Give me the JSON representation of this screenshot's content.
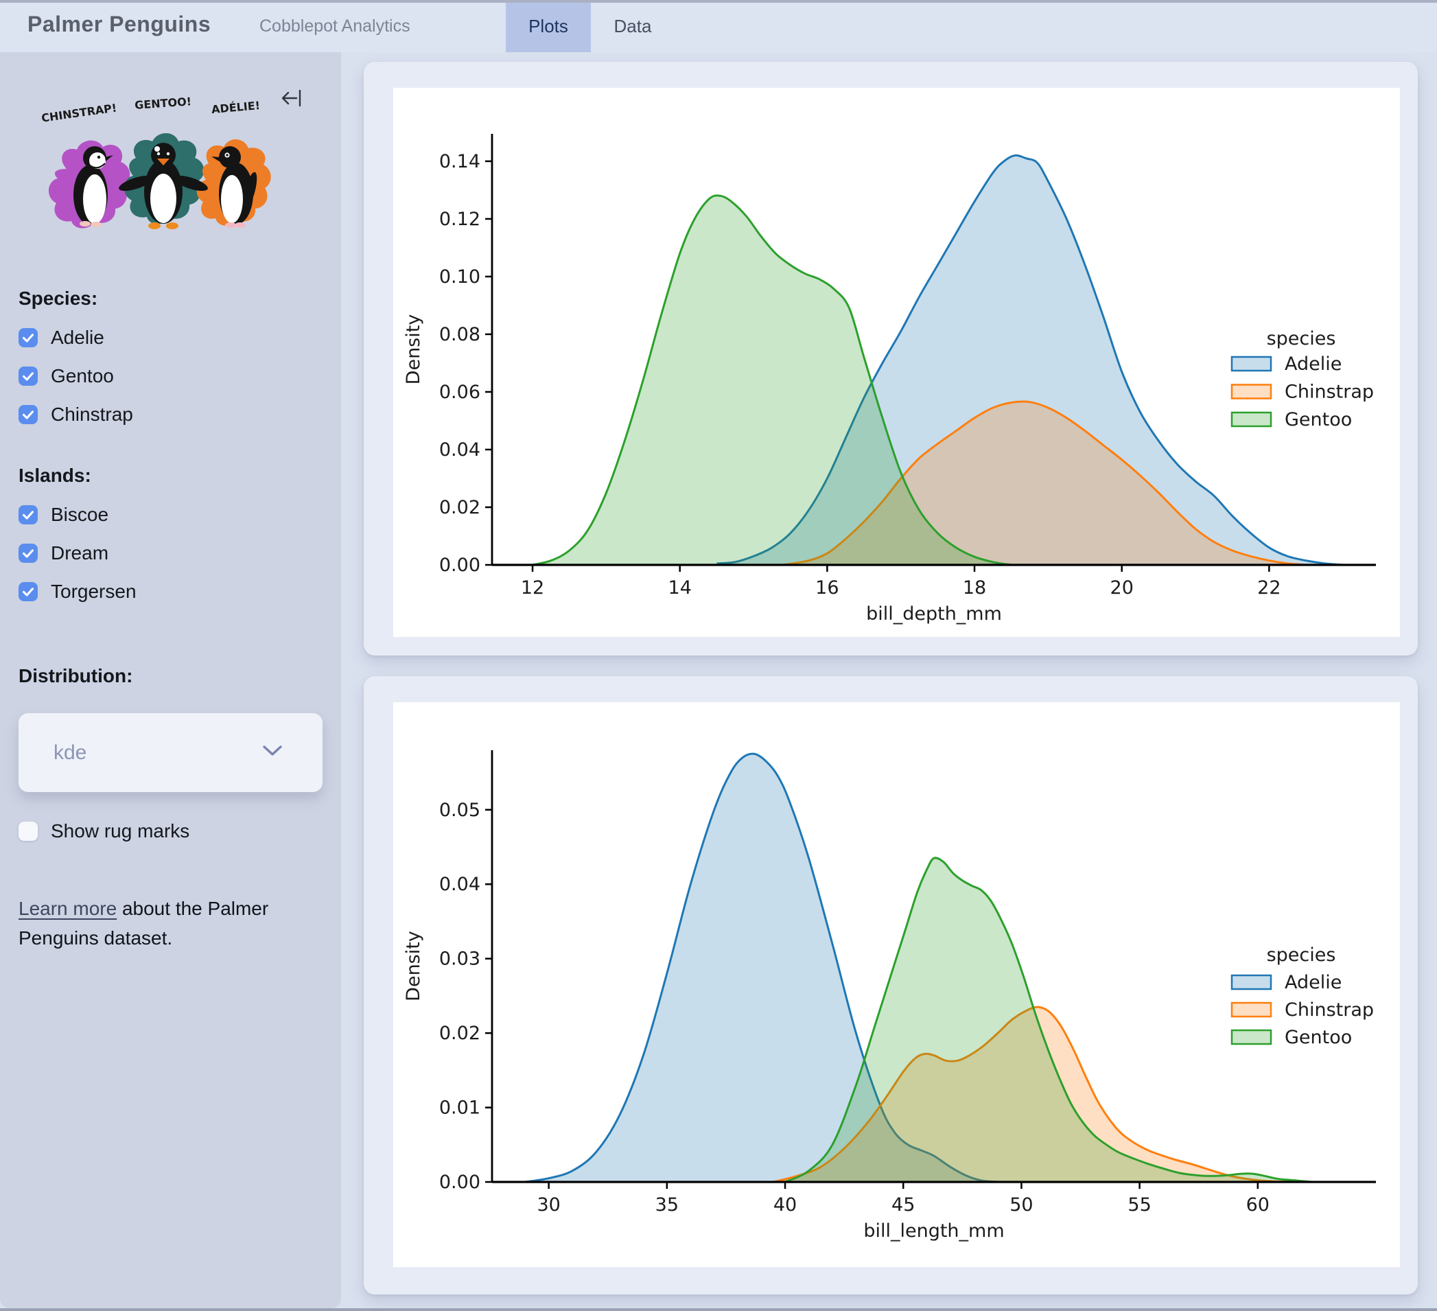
{
  "header": {
    "title": "Palmer Penguins",
    "subtitle": "Cobblepot Analytics",
    "tabs": [
      {
        "label": "Plots",
        "active": true
      },
      {
        "label": "Data",
        "active": false
      }
    ]
  },
  "sidebar": {
    "artwork_labels": {
      "chinstrap": "CHINSTRAP!",
      "gentoo": "GENTOO!",
      "adelie": "ADÉLIE!"
    },
    "species": {
      "label": "Species:",
      "options": [
        {
          "label": "Adelie",
          "checked": true
        },
        {
          "label": "Gentoo",
          "checked": true
        },
        {
          "label": "Chinstrap",
          "checked": true
        }
      ]
    },
    "islands": {
      "label": "Islands:",
      "options": [
        {
          "label": "Biscoe",
          "checked": true
        },
        {
          "label": "Dream",
          "checked": true
        },
        {
          "label": "Torgersen",
          "checked": true
        }
      ]
    },
    "distribution": {
      "label": "Distribution:",
      "value": "kde"
    },
    "rug": {
      "label": "Show rug marks",
      "checked": false
    },
    "footer": {
      "link_text": "Learn more",
      "rest": " about the Palmer Penguins dataset."
    }
  },
  "colors": {
    "adelie": "#1f77b4",
    "chinstrap": "#ff7f0e",
    "gentoo": "#2ca02c",
    "checkbox_accent": "#5a8dee",
    "active_tab_bg": "#b5c4e6"
  },
  "chart_data": [
    {
      "type": "area",
      "subtype": "kde",
      "title": "",
      "xlabel": "bill_depth_mm",
      "ylabel": "Density",
      "xlim": [
        11.45,
        23.45
      ],
      "ylim": [
        0,
        0.1495
      ],
      "xticks": [
        12,
        14,
        16,
        18,
        20,
        22
      ],
      "yticks": [
        0.0,
        0.02,
        0.04,
        0.06,
        0.08,
        0.1,
        0.12,
        0.14
      ],
      "grid": false,
      "legend": {
        "title": "species",
        "position": "right"
      },
      "series": [
        {
          "name": "Adelie",
          "color": "#1f77b4",
          "points": [
            [
              14.5,
              0.0005
            ],
            [
              14.75,
              0.001
            ],
            [
              15.0,
              0.003
            ],
            [
              15.25,
              0.006
            ],
            [
              15.5,
              0.011
            ],
            [
              15.75,
              0.019
            ],
            [
              16.0,
              0.03
            ],
            [
              16.25,
              0.044
            ],
            [
              16.5,
              0.058
            ],
            [
              16.75,
              0.07
            ],
            [
              17.0,
              0.081
            ],
            [
              17.25,
              0.093
            ],
            [
              17.5,
              0.104
            ],
            [
              17.75,
              0.115
            ],
            [
              18.0,
              0.126
            ],
            [
              18.25,
              0.136
            ],
            [
              18.4,
              0.14
            ],
            [
              18.55,
              0.142
            ],
            [
              18.7,
              0.141
            ],
            [
              18.85,
              0.1395
            ],
            [
              19.0,
              0.133
            ],
            [
              19.25,
              0.12
            ],
            [
              19.5,
              0.104
            ],
            [
              19.75,
              0.086
            ],
            [
              20.0,
              0.067
            ],
            [
              20.25,
              0.053
            ],
            [
              20.5,
              0.043
            ],
            [
              20.75,
              0.035
            ],
            [
              21.0,
              0.029
            ],
            [
              21.25,
              0.024
            ],
            [
              21.5,
              0.017
            ],
            [
              21.75,
              0.011
            ],
            [
              22.0,
              0.006
            ],
            [
              22.25,
              0.003
            ],
            [
              22.5,
              0.0015
            ],
            [
              22.75,
              0.0005
            ],
            [
              23.0,
              0.0
            ]
          ]
        },
        {
          "name": "Chinstrap",
          "color": "#ff7f0e",
          "points": [
            [
              15.4,
              0.0
            ],
            [
              15.75,
              0.0015
            ],
            [
              16.0,
              0.004
            ],
            [
              16.25,
              0.009
            ],
            [
              16.5,
              0.015
            ],
            [
              16.75,
              0.022
            ],
            [
              17.0,
              0.03
            ],
            [
              17.25,
              0.037
            ],
            [
              17.5,
              0.042
            ],
            [
              17.75,
              0.0465
            ],
            [
              18.0,
              0.051
            ],
            [
              18.25,
              0.0545
            ],
            [
              18.5,
              0.0563
            ],
            [
              18.75,
              0.0565
            ],
            [
              19.0,
              0.0545
            ],
            [
              19.25,
              0.051
            ],
            [
              19.5,
              0.0465
            ],
            [
              19.75,
              0.0415
            ],
            [
              20.0,
              0.0365
            ],
            [
              20.25,
              0.031
            ],
            [
              20.5,
              0.025
            ],
            [
              20.75,
              0.0185
            ],
            [
              21.0,
              0.0125
            ],
            [
              21.25,
              0.008
            ],
            [
              21.5,
              0.005
            ],
            [
              21.75,
              0.003
            ],
            [
              22.0,
              0.0015
            ],
            [
              22.25,
              0.0005
            ],
            [
              22.5,
              0.0
            ]
          ]
        },
        {
          "name": "Gentoo",
          "color": "#2ca02c",
          "points": [
            [
              12.0,
              0.0
            ],
            [
              12.25,
              0.0015
            ],
            [
              12.5,
              0.005
            ],
            [
              12.75,
              0.012
            ],
            [
              13.0,
              0.025
            ],
            [
              13.25,
              0.043
            ],
            [
              13.5,
              0.064
            ],
            [
              13.75,
              0.087
            ],
            [
              14.0,
              0.108
            ],
            [
              14.2,
              0.12
            ],
            [
              14.4,
              0.127
            ],
            [
              14.55,
              0.128
            ],
            [
              14.7,
              0.126
            ],
            [
              14.9,
              0.121
            ],
            [
              15.1,
              0.114
            ],
            [
              15.3,
              0.108
            ],
            [
              15.5,
              0.104
            ],
            [
              15.7,
              0.101
            ],
            [
              15.9,
              0.099
            ],
            [
              16.1,
              0.0955
            ],
            [
              16.3,
              0.089
            ],
            [
              16.5,
              0.072
            ],
            [
              16.75,
              0.051
            ],
            [
              17.0,
              0.032
            ],
            [
              17.25,
              0.019
            ],
            [
              17.5,
              0.011
            ],
            [
              17.75,
              0.006
            ],
            [
              18.0,
              0.0028
            ],
            [
              18.25,
              0.001
            ],
            [
              18.5,
              0.0
            ]
          ]
        }
      ]
    },
    {
      "type": "area",
      "subtype": "kde",
      "title": "",
      "xlabel": "bill_length_mm",
      "ylabel": "Density",
      "xlim": [
        27.6,
        65.0
      ],
      "ylim": [
        0,
        0.058
      ],
      "xticks": [
        30,
        35,
        40,
        45,
        50,
        55,
        60
      ],
      "yticks": [
        0.0,
        0.01,
        0.02,
        0.03,
        0.04,
        0.05
      ],
      "grid": false,
      "legend": {
        "title": "species",
        "position": "right"
      },
      "series": [
        {
          "name": "Adelie",
          "color": "#1f77b4",
          "points": [
            [
              29.0,
              0.0
            ],
            [
              30.0,
              0.0005
            ],
            [
              31.0,
              0.0015
            ],
            [
              32.0,
              0.004
            ],
            [
              33.0,
              0.009
            ],
            [
              34.0,
              0.017
            ],
            [
              35.0,
              0.028
            ],
            [
              36.0,
              0.04
            ],
            [
              37.0,
              0.05
            ],
            [
              37.7,
              0.055
            ],
            [
              38.2,
              0.057
            ],
            [
              38.7,
              0.0575
            ],
            [
              39.2,
              0.0565
            ],
            [
              39.7,
              0.0545
            ],
            [
              40.2,
              0.051
            ],
            [
              41.0,
              0.0435
            ],
            [
              42.0,
              0.032
            ],
            [
              43.0,
              0.02
            ],
            [
              44.0,
              0.0105
            ],
            [
              44.6,
              0.0068
            ],
            [
              45.2,
              0.005
            ],
            [
              45.8,
              0.0042
            ],
            [
              46.3,
              0.0035
            ],
            [
              47.0,
              0.002
            ],
            [
              47.7,
              0.0008
            ],
            [
              48.3,
              0.0002
            ],
            [
              49.0,
              0.0
            ]
          ]
        },
        {
          "name": "Chinstrap",
          "color": "#ff7f0e",
          "points": [
            [
              39.5,
              0.0
            ],
            [
              40.5,
              0.0008
            ],
            [
              41.5,
              0.002
            ],
            [
              42.5,
              0.0045
            ],
            [
              43.5,
              0.008
            ],
            [
              44.3,
              0.0115
            ],
            [
              45.0,
              0.0148
            ],
            [
              45.5,
              0.0166
            ],
            [
              45.9,
              0.0172
            ],
            [
              46.3,
              0.017
            ],
            [
              46.8,
              0.0163
            ],
            [
              47.3,
              0.0163
            ],
            [
              47.8,
              0.017
            ],
            [
              48.4,
              0.0183
            ],
            [
              49.0,
              0.02
            ],
            [
              49.6,
              0.0218
            ],
            [
              50.2,
              0.023
            ],
            [
              50.7,
              0.0235
            ],
            [
              51.2,
              0.0228
            ],
            [
              51.7,
              0.0208
            ],
            [
              52.2,
              0.0178
            ],
            [
              52.7,
              0.0143
            ],
            [
              53.2,
              0.011
            ],
            [
              53.7,
              0.0085
            ],
            [
              54.2,
              0.0066
            ],
            [
              54.8,
              0.0052
            ],
            [
              55.4,
              0.0042
            ],
            [
              56.0,
              0.0035
            ],
            [
              56.6,
              0.0029
            ],
            [
              57.2,
              0.0024
            ],
            [
              57.8,
              0.0018
            ],
            [
              58.4,
              0.0012
            ],
            [
              59.0,
              0.0007
            ],
            [
              59.8,
              0.0003
            ],
            [
              60.6,
              0.0001
            ],
            [
              61.5,
              0.0
            ]
          ]
        },
        {
          "name": "Gentoo",
          "color": "#2ca02c",
          "points": [
            [
              40.0,
              0.0
            ],
            [
              41.0,
              0.0015
            ],
            [
              42.0,
              0.005
            ],
            [
              43.0,
              0.013
            ],
            [
              43.8,
              0.021
            ],
            [
              44.5,
              0.028
            ],
            [
              45.1,
              0.034
            ],
            [
              45.6,
              0.039
            ],
            [
              46.0,
              0.042
            ],
            [
              46.3,
              0.0435
            ],
            [
              46.7,
              0.043
            ],
            [
              47.1,
              0.0415
            ],
            [
              47.5,
              0.0405
            ],
            [
              47.9,
              0.0398
            ],
            [
              48.3,
              0.0392
            ],
            [
              48.7,
              0.0378
            ],
            [
              49.1,
              0.0355
            ],
            [
              49.6,
              0.032
            ],
            [
              50.1,
              0.0275
            ],
            [
              50.6,
              0.0225
            ],
            [
              51.1,
              0.018
            ],
            [
              51.6,
              0.014
            ],
            [
              52.1,
              0.0105
            ],
            [
              52.6,
              0.008
            ],
            [
              53.1,
              0.0062
            ],
            [
              53.6,
              0.005
            ],
            [
              54.1,
              0.004
            ],
            [
              54.7,
              0.0032
            ],
            [
              55.3,
              0.0025
            ],
            [
              56.0,
              0.0018
            ],
            [
              56.7,
              0.0012
            ],
            [
              57.4,
              0.0009
            ],
            [
              58.1,
              0.0008
            ],
            [
              58.7,
              0.0009
            ],
            [
              59.3,
              0.0011
            ],
            [
              59.8,
              0.0011
            ],
            [
              60.3,
              0.0008
            ],
            [
              60.9,
              0.0004
            ],
            [
              61.6,
              0.0002
            ],
            [
              62.3,
              0.0
            ]
          ]
        }
      ]
    }
  ]
}
